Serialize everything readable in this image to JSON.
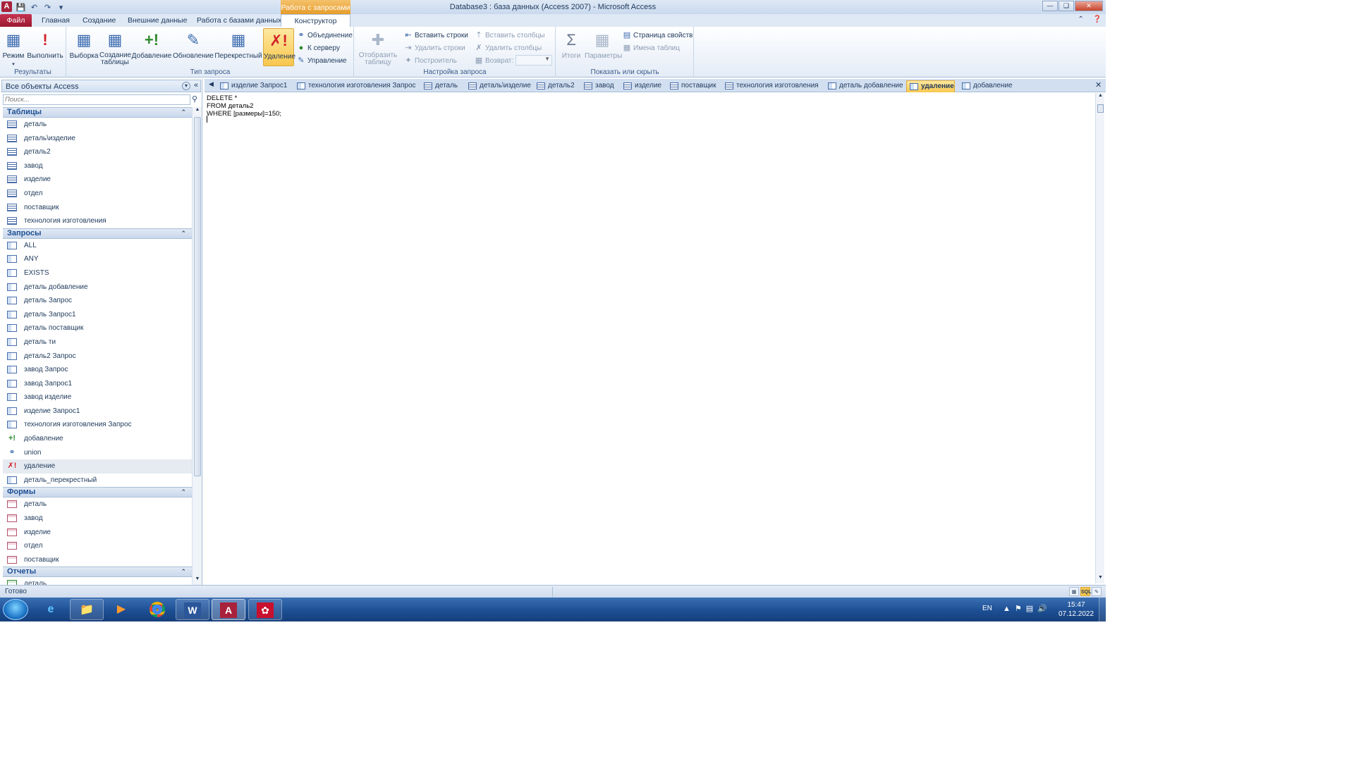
{
  "window": {
    "title": "Database3 : база данных (Access 2007)  -  Microsoft Access",
    "app_icon": "A",
    "context_tab_header": "Работа с запросами"
  },
  "ribbon_tabs": [
    "Файл",
    "Главная",
    "Создание",
    "Внешние данные",
    "Работа с базами данных",
    "Конструктор"
  ],
  "ribbon": {
    "results": {
      "label": "Результаты",
      "mode": "Режим",
      "run": "Выполнить"
    },
    "query_type": {
      "label": "Тип запроса",
      "select": "Выборка",
      "make_table": "Создание таблицы",
      "append": "Добавление",
      "update": "Обновление",
      "crosstab": "Перекрестный",
      "delete": "Удаление",
      "union": "Объединение",
      "pass_through": "К серверу",
      "data_definition": "Управление"
    },
    "query_setup": {
      "label": "Настройка запроса",
      "show_table": "Отобразить таблицу",
      "insert_rows": "Вставить строки",
      "delete_rows": "Удалить строки",
      "builder": "Построитель",
      "insert_columns": "Вставить столбцы",
      "delete_columns": "Удалить столбцы",
      "return": "Возврат:"
    },
    "show_hide": {
      "label": "Показать или скрыть",
      "totals": "Итоги",
      "parameters": "Параметры",
      "property_sheet": "Страница свойств",
      "table_names": "Имена таблиц"
    }
  },
  "nav": {
    "title": "Все объекты Access",
    "search_placeholder": "Поиск...",
    "sections": [
      {
        "name": "Таблицы",
        "type": "table",
        "items": [
          "деталь",
          "деталь\\изделие",
          "деталь2",
          "завод",
          "изделие",
          "отдел",
          "поставщик",
          "технология изготовления"
        ]
      },
      {
        "name": "Запросы",
        "type": "query",
        "items": [
          "ALL",
          "ANY",
          "EXISTS",
          "деталь добавление",
          "деталь Запрос",
          "деталь Запрос1",
          "деталь поставщик",
          "деталь ти",
          "деталь2 Запрос",
          "завод Запрос",
          "завод Запрос1",
          "завод изделие",
          "изделие Запрос1",
          "технология изготовления Запрос",
          "добавление",
          "union",
          "удаление",
          "деталь_перекрестный"
        ]
      },
      {
        "name": "Формы",
        "type": "form",
        "items": [
          "деталь",
          "завод",
          "изделие",
          "отдел",
          "поставщик"
        ]
      },
      {
        "name": "Отчеты",
        "type": "report",
        "items": [
          "деталь"
        ]
      }
    ],
    "selected_item": "удаление"
  },
  "doc_tabs": [
    {
      "label": "изделие Запрос1",
      "type": "query"
    },
    {
      "label": "технология изготовления Запрос",
      "type": "query"
    },
    {
      "label": "деталь",
      "type": "table"
    },
    {
      "label": "деталь\\изделие",
      "type": "table"
    },
    {
      "label": "деталь2",
      "type": "table"
    },
    {
      "label": "завод",
      "type": "table"
    },
    {
      "label": "изделие",
      "type": "table"
    },
    {
      "label": "поставщик",
      "type": "table"
    },
    {
      "label": "технология изготовления",
      "type": "table"
    },
    {
      "label": "деталь добавление",
      "type": "query"
    },
    {
      "label": "удаление",
      "type": "query",
      "active": true
    },
    {
      "label": "добавление",
      "type": "query"
    }
  ],
  "sql": [
    "DELETE *",
    "FROM деталь2",
    "WHERE [размеры]=150;"
  ],
  "status": {
    "text": "Готово",
    "view_sql": "SQL"
  },
  "taskbar": {
    "lang": "EN",
    "time": "15:47",
    "date": "07.12.2022",
    "apps": [
      "internet-explorer",
      "file-explorer",
      "media-player",
      "chrome",
      "word",
      "access",
      "acrobat-reader"
    ]
  },
  "colors": {
    "accent_file": "#a8223b",
    "context_orange": "#e69d2a",
    "ribbon_blue": "#dfe9f5",
    "taskbar": "#1d4f94"
  }
}
